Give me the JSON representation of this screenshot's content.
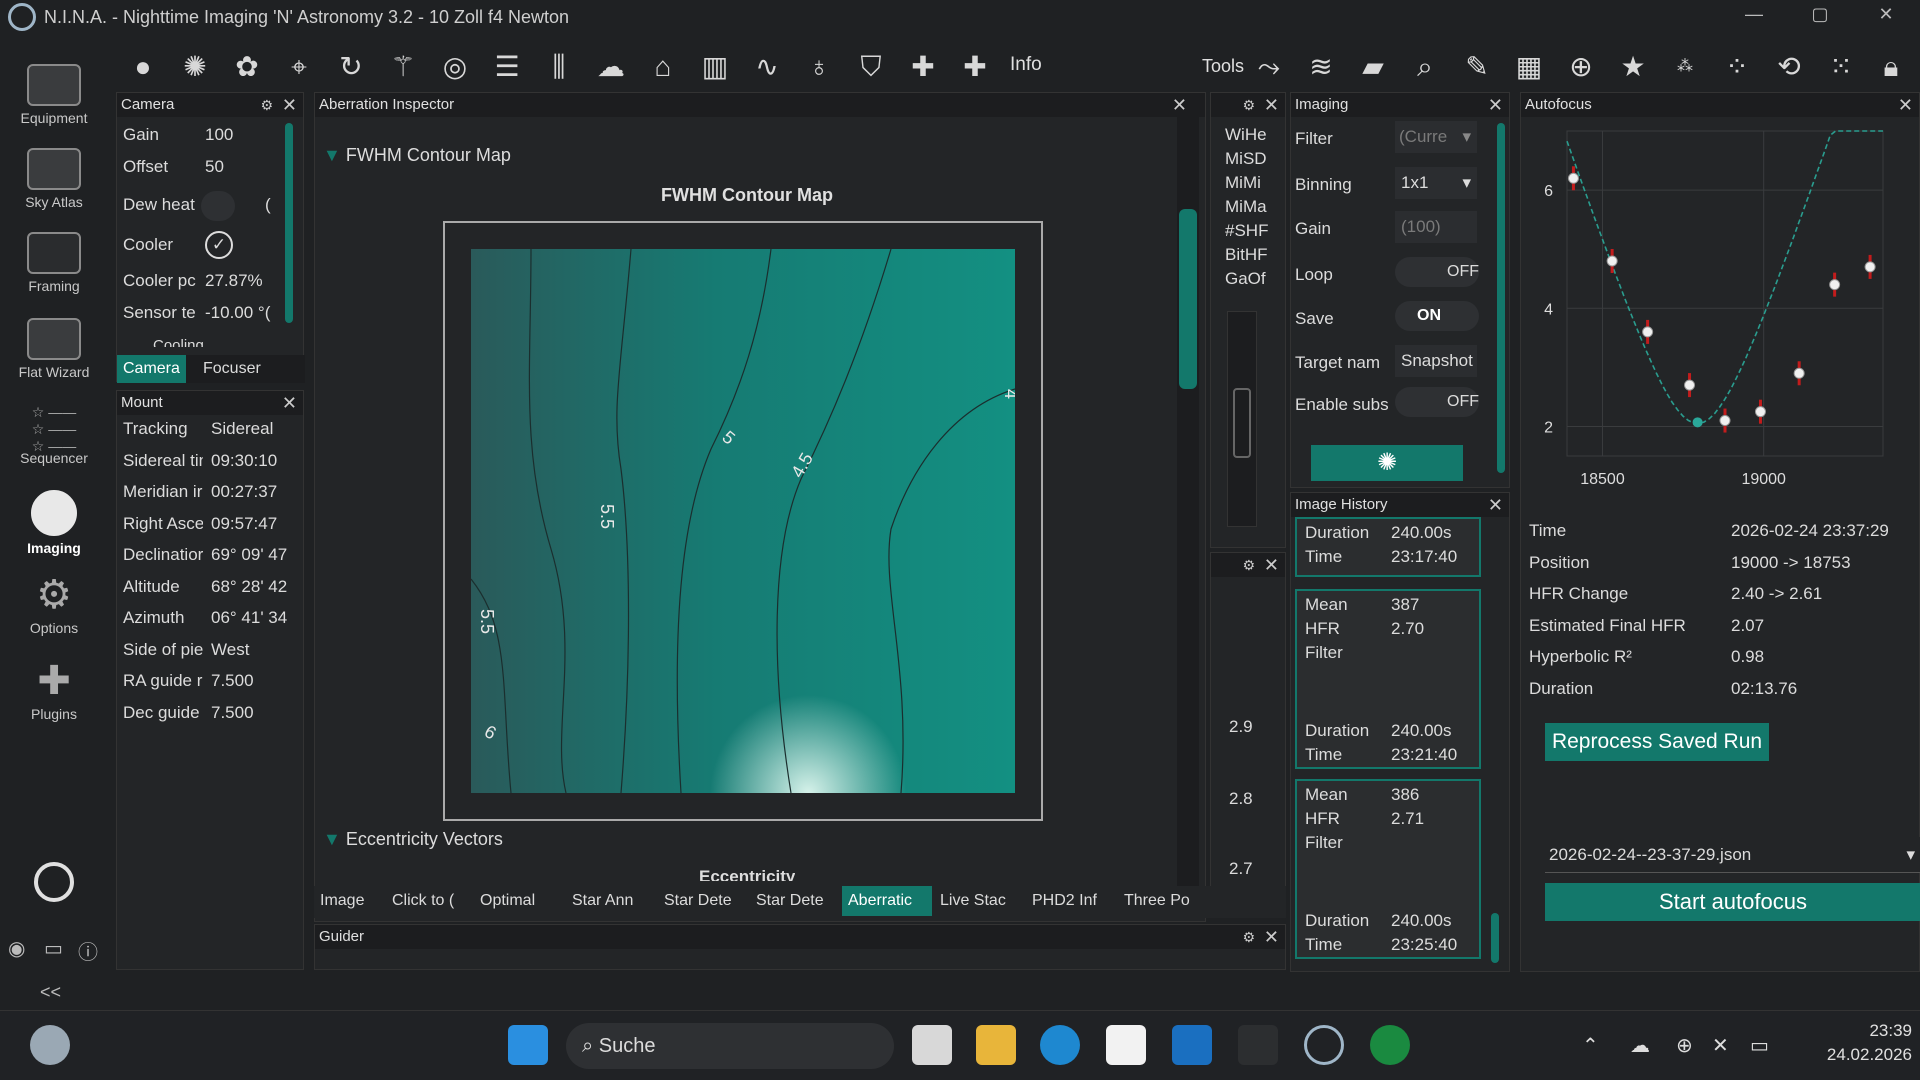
{
  "window": {
    "title": "N.I.N.A. - Nighttime Imaging 'N' Astronomy 3.2   -  10 Zoll f4 Newton",
    "minimize_icon": "minimize-icon",
    "maximize_icon": "maximize-icon",
    "close_icon": "close-icon"
  },
  "nav": {
    "items": [
      {
        "label": "Equipment"
      },
      {
        "label": "Sky Atlas"
      },
      {
        "label": "Framing"
      },
      {
        "label": "Flat Wizard"
      },
      {
        "label": "Sequencer"
      },
      {
        "label": "Imaging"
      },
      {
        "label": "Options"
      },
      {
        "label": "Plugins"
      }
    ],
    "collapse": "<<"
  },
  "toolbar": {
    "info_label": "Info",
    "tools_label": "Tools"
  },
  "camera": {
    "title": "Camera",
    "rows": [
      {
        "k": "Gain",
        "v": "100"
      },
      {
        "k": "Offset",
        "v": "50"
      },
      {
        "k": "Dew heat",
        "v": "("
      },
      {
        "k": "Cooler",
        "v": ""
      },
      {
        "k": "Cooler pc",
        "v": "27.87%"
      },
      {
        "k": "Sensor te",
        "v": "-10.00 °("
      },
      {
        "k": "Cooling",
        "v": ""
      }
    ],
    "tab1": "Camera",
    "tab2": "Focuser"
  },
  "mount": {
    "title": "Mount",
    "rows": [
      {
        "k": "Tracking",
        "v": "Sidereal"
      },
      {
        "k": "Sidereal tin",
        "v": "09:30:10"
      },
      {
        "k": "Meridian ir",
        "v": "00:27:37"
      },
      {
        "k": "Right Ascei",
        "v": "09:57:47"
      },
      {
        "k": "Declinatior",
        "v": "69° 09' 47"
      },
      {
        "k": "Altitude",
        "v": "68° 28' 42"
      },
      {
        "k": "Azimuth",
        "v": "06° 41' 34"
      },
      {
        "k": "Side of piei",
        "v": "West"
      },
      {
        "k": "RA guide ra",
        "v": "7.500"
      },
      {
        "k": "Dec guide",
        "v": "7.500"
      }
    ]
  },
  "aberration": {
    "title": "Aberration Inspector",
    "section1": "FWHM Contour Map",
    "chart_title": "FWHM Contour Map",
    "contours": [
      "5.5",
      "5",
      "4.5",
      "4",
      "6",
      "5.5",
      "6"
    ],
    "section2": "Eccentricity Vectors",
    "section2_sub": "Eccentricity"
  },
  "bottom_tabs": [
    "Image",
    "Click to (",
    "Optimal",
    "Star Ann",
    "Star Dete",
    "Star Dete",
    "Aberratic",
    "Live Stac",
    "PHD2 Inf",
    "Three Po"
  ],
  "guider": {
    "title": "Guider"
  },
  "side_list": [
    "WiHe",
    "MiSD",
    "MiMi",
    "MiMa",
    "#SHF",
    "BitHF",
    "GaOf"
  ],
  "mini_axis": [
    "2.9",
    "2.8",
    "2.7"
  ],
  "imaging": {
    "title": "Imaging",
    "rows": [
      {
        "k": "Filter",
        "v": "(Curre"
      },
      {
        "k": "Binning",
        "v": "1x1"
      },
      {
        "k": "Gain",
        "v": "(100)"
      },
      {
        "k": "Loop",
        "v": "OFF"
      },
      {
        "k": "Save",
        "v": "ON"
      },
      {
        "k": "Target nam",
        "v": "Snapshot"
      },
      {
        "k": "Enable subs",
        "v": "OFF"
      }
    ]
  },
  "history": {
    "title": "Image History",
    "items": [
      {
        "duration_k": "Duration",
        "duration": "240.00s",
        "time_k": "Time",
        "time": "23:17:40"
      },
      {
        "mean_k": "Mean",
        "mean": "387",
        "hfr_k": "HFR",
        "hfr": "2.70",
        "filter_k": "Filter",
        "duration_k": "Duration",
        "duration": "240.00s",
        "time_k": "Time",
        "time": "23:21:40"
      },
      {
        "mean_k": "Mean",
        "mean": "386",
        "hfr_k": "HFR",
        "hfr": "2.71",
        "filter_k": "Filter",
        "duration_k": "Duration",
        "duration": "240.00s",
        "time_k": "Time",
        "time": "23:25:40"
      }
    ]
  },
  "autofocus": {
    "title": "Autofocus",
    "stats": [
      {
        "k": "Time",
        "v": "2026-02-24 23:37:29"
      },
      {
        "k": "Position",
        "v": "19000 -> 18753"
      },
      {
        "k": "HFR Change",
        "v": "2.40 -> 2.61"
      },
      {
        "k": "Estimated Final HFR",
        "v": "2.07"
      },
      {
        "k": "Hyperbolic R²",
        "v": "0.98"
      },
      {
        "k": "Duration",
        "v": "02:13.76"
      }
    ],
    "reprocess": "Reprocess Saved Run",
    "file": "2026-02-24--23-37-29.json",
    "start": "Start autofocus"
  },
  "chart_data": {
    "type": "scatter",
    "x": [
      18410,
      18530,
      18640,
      18770,
      18880,
      18990,
      19110,
      19220,
      19330
    ],
    "y": [
      6.2,
      4.8,
      3.6,
      2.7,
      2.1,
      2.25,
      2.9,
      4.4,
      4.7
    ],
    "xticks": [
      "18500",
      "19000"
    ],
    "yticks": [
      "6",
      "4",
      "2"
    ],
    "ylim": [
      1.5,
      7.0
    ],
    "xlim": [
      18390,
      19370
    ],
    "colors": {
      "points": "#f0f0f0",
      "error": "#c21c1c",
      "fit": "#2a9d8f"
    }
  },
  "taskbar": {
    "search": "Suche",
    "time": "23:39",
    "date": "24.02.2026"
  }
}
